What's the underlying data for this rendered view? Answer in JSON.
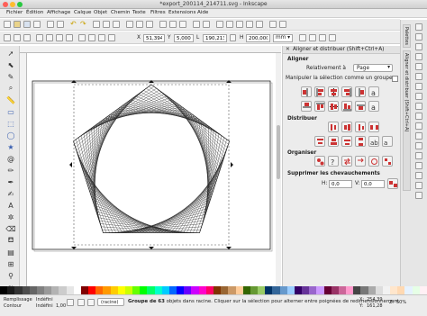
{
  "window": {
    "title": "*export_200114_214711.svg - Inkscape"
  },
  "menu": [
    "Fichier",
    "Édition",
    "Affichage",
    "Calque",
    "Objet",
    "Chemin",
    "Texte",
    "Filtres",
    "Extensions",
    "Aide"
  ],
  "controls": {
    "x_label": "X",
    "x_value": "51,394",
    "y_label": "Y",
    "y_value": "5,000",
    "w_label": "L",
    "w_value": "190,213",
    "h_label": "H",
    "h_value": "200,000",
    "unit": "mm"
  },
  "panel": {
    "title": "Aligner et distribuer (Shift+Ctrl+A)",
    "align_heading": "Aligner",
    "relative_label": "Relativement à",
    "relative_value": "Page",
    "group_label": "Manipuler la sélection comme un groupe",
    "distribute_heading": "Distribuer",
    "organize_heading": "Organiser",
    "overlap_heading": "Supprimer les chevauchements",
    "h_label": "H:",
    "h_value": "0,0",
    "v_label": "V:",
    "v_value": "0,0"
  },
  "side_tab": "Aligner et distribuer (Shift+Ctrl+A)",
  "side_tab2": "Palettes",
  "status": {
    "fill_label": "Remplissage",
    "fill_value": "Indéfini",
    "stroke_label": "Contour",
    "stroke_value": "Indéfini",
    "stroke_width": "1,00",
    "layer": "(racine)",
    "message_bold": "Groupe de 63",
    "message": " objets dans racine. Cliquer sur la sélection pour alterner entre poignées de redimensionnement",
    "x_label": "X:",
    "x_value": "254,39",
    "y_label": "Y:",
    "y_value": "161,28",
    "zoom_label": "Z:",
    "zoom_value": "50%"
  },
  "colors": {
    "accent": "#3d7bd9",
    "canvas_bg": "#ffffff",
    "chrome": "#ececec"
  },
  "palette": [
    "#000000",
    "#1a1a1a",
    "#333333",
    "#4d4d4d",
    "#666666",
    "#808080",
    "#999999",
    "#b3b3b3",
    "#cccccc",
    "#e6e6e6",
    "#ffffff",
    "#800000",
    "#ff0000",
    "#ff6600",
    "#ff9900",
    "#ffcc00",
    "#ffff00",
    "#ccff00",
    "#66ff00",
    "#00ff00",
    "#00ff66",
    "#00ffcc",
    "#00ccff",
    "#0066ff",
    "#0000ff",
    "#6600ff",
    "#cc00ff",
    "#ff00cc",
    "#ff0066",
    "#803300",
    "#996633",
    "#cc9966",
    "#ffcc99",
    "#336600",
    "#669933",
    "#99cc66",
    "#003366",
    "#336699",
    "#6699cc",
    "#99ccff",
    "#330066",
    "#663399",
    "#9966cc",
    "#cc99ff",
    "#660033",
    "#993366",
    "#cc6699",
    "#ff99cc",
    "#444444",
    "#777777",
    "#aaaaaa",
    "#dddddd",
    "#f2f2f2",
    "#ffe6cc",
    "#ffd9b3",
    "#e6f2ff",
    "#e6ffe6",
    "#fff0f5"
  ]
}
